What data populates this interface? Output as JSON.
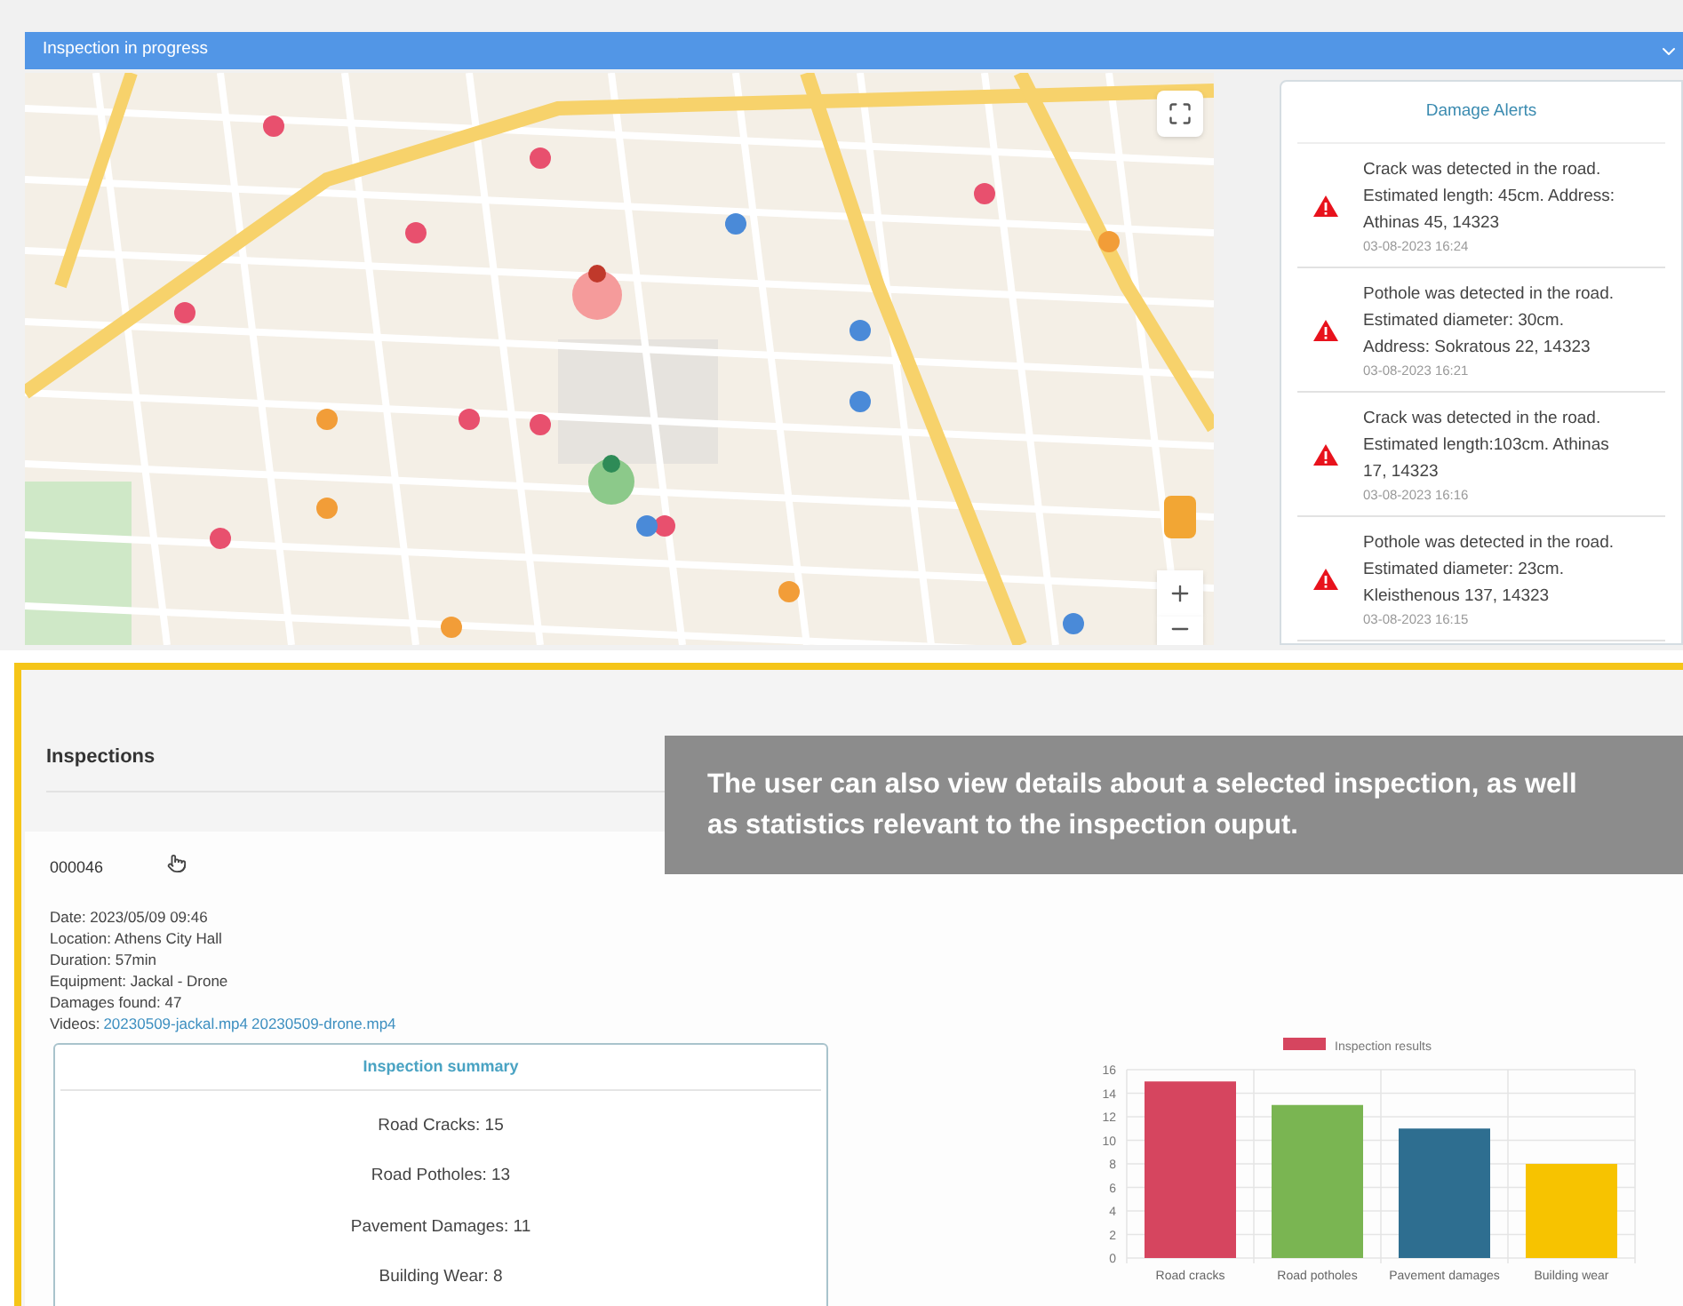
{
  "banner": {
    "title": "Inspection in progress"
  },
  "damage_alerts": {
    "title": "Damage Alerts",
    "items": [
      {
        "message": "Crack was detected in the road. Estimated length: 45cm. Address: Athinas 45, 14323",
        "time": "03-08-2023 16:24"
      },
      {
        "message": "Pothole was detected in the road. Estimated diameter: 30cm. Address: Sokratous 22, 14323",
        "time": "03-08-2023 16:21"
      },
      {
        "message": "Crack was detected in the road. Estimated length:103cm. Athinas 17, 14323",
        "time": "03-08-2023 16:16"
      },
      {
        "message": "Pothole was detected in the road. Estimated diameter: 23cm. Kleisthenous 137, 14323",
        "time": "03-08-2023 16:15"
      }
    ]
  },
  "inspections": {
    "title": "Inspections",
    "id": "000046",
    "details": [
      "Date: 2023/05/09 09:46",
      "Location: Athens City Hall",
      "Duration: 57min",
      "Equipment: Jackal - Drone",
      "Damages found: 47"
    ],
    "videos": {
      "label": "Videos:",
      "links": [
        "20230509-jackal.mp4",
        "20230509-drone.mp4"
      ]
    },
    "summary": {
      "title": "Inspection summary",
      "items": [
        "Road Cracks: 15",
        "Road Potholes: 13",
        "Pavement Damages: 11",
        "Building Wear: 8"
      ]
    },
    "chart_data": {
      "type": "bar",
      "categories": [
        "Road cracks",
        "Road potholes",
        "Pavement damages",
        "Building wear"
      ],
      "series": [
        {
          "name": "Inspection results",
          "values": [
            15,
            13,
            11,
            8
          ]
        }
      ],
      "colors": [
        "#d6455f",
        "#7ab552",
        "#2e6e90",
        "#f7c300"
      ],
      "grid": true,
      "ylim": [
        0,
        16
      ],
      "yticks": [
        0,
        2,
        4,
        6,
        8,
        10,
        12,
        14,
        16
      ]
    }
  },
  "callout": {
    "text": "The user can also view details about a selected inspection, as well as statistics relevant to the inspection ouput."
  }
}
